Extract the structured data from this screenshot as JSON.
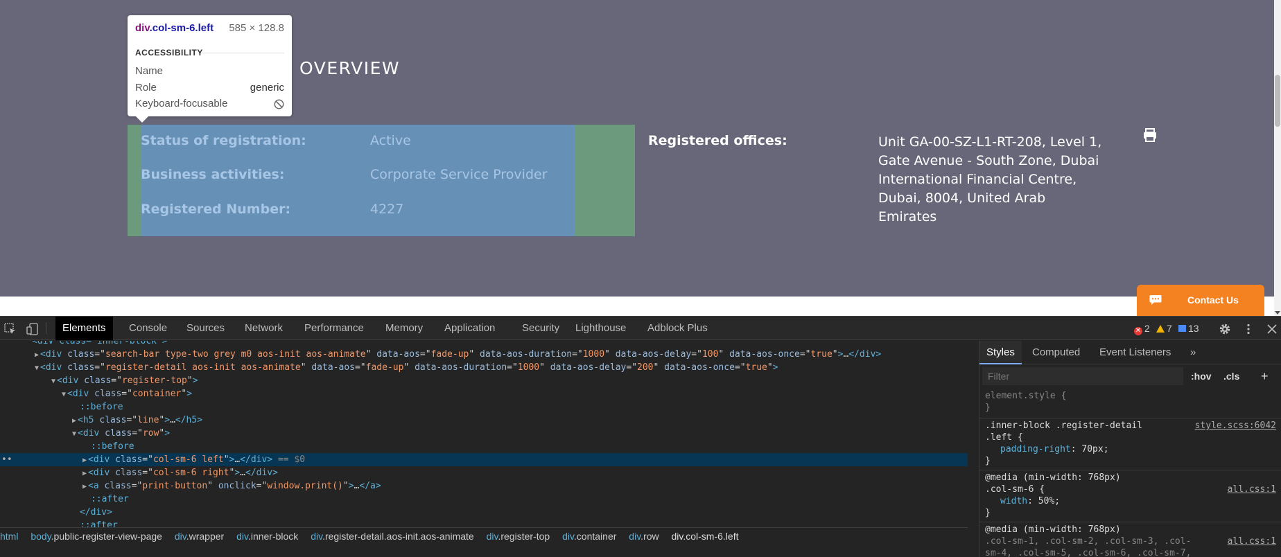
{
  "page": {
    "overview_title": "OVERVIEW",
    "registration": [
      {
        "label": "Status of registration:",
        "value": "Active"
      },
      {
        "label": "Business activities:",
        "value": "Corporate Service Provider"
      },
      {
        "label": "Registered Number:",
        "value": "4227"
      }
    ],
    "offices_label": "Registered offices:",
    "offices_address": "Unit GA-00-SZ-L1-RT-208, Level 1, Gate Avenue - South Zone, Dubai International Financial Centre, Dubai, 8004, United Arab Emirates",
    "print_icon": "printer-icon",
    "contact_label": "Contact Us",
    "contact_icon": "chat-bubble-icon"
  },
  "tooltip": {
    "tag": "div",
    "cls": ".col-sm-6.left",
    "dimensions": "585 × 128.8",
    "section": "ACCESSIBILITY",
    "name_key": "Name",
    "name_val": "",
    "role_key": "Role",
    "role_val": "generic",
    "focus_key": "Keyboard-focusable",
    "focus_icon": "not-allowed-icon"
  },
  "devtools": {
    "tabs": [
      "Elements",
      "Console",
      "Sources",
      "Network",
      "Performance",
      "Memory",
      "Application",
      "Security",
      "Lighthouse",
      "Adblock Plus"
    ],
    "active_tab": "Elements",
    "errors": "2",
    "warnings": "7",
    "messages": "13",
    "code": {
      "l0": "<div class=\"inner-block\">",
      "l1_tag": "div",
      "l1_class": "search-bar type-two grey m0 aos-init aos-animate",
      "l1_aos": "fade-up",
      "l1_dur": "1000",
      "l1_delay": "100",
      "l1_once": "true",
      "l2_class": "register-detail aos-init aos-animate",
      "l2_aos": "fade-up",
      "l2_dur": "1000",
      "l2_delay": "200",
      "l2_once": "true",
      "l3_class": "register-top",
      "l4_class": "container",
      "before": "::before",
      "l6_class": "line",
      "l7_class": "row",
      "l9_class": "col-sm-6 left",
      "selected_marker": "== $0",
      "l10_class": "col-sm-6 right",
      "l11_class": "print-button",
      "l11_onclick": "window.print()",
      "after": "::after"
    },
    "breadcrumbs": [
      {
        "tag": "html",
        "cls": ""
      },
      {
        "tag": "body",
        "cls": ".public-register-view-page"
      },
      {
        "tag": "div",
        "cls": ".wrapper"
      },
      {
        "tag": "div",
        "cls": ".inner-block"
      },
      {
        "tag": "div",
        "cls": ".register-detail.aos-init.aos-animate"
      },
      {
        "tag": "div",
        "cls": ".register-top"
      },
      {
        "tag": "div",
        "cls": ".container"
      },
      {
        "tag": "div",
        "cls": ".row"
      },
      {
        "tag": "div",
        "cls": ".col-sm-6.left"
      }
    ],
    "styles": {
      "tabs": [
        "Styles",
        "Computed",
        "Event Listeners"
      ],
      "more": "»",
      "filter_placeholder": "Filter",
      "hov": ":hov",
      "cls": ".cls",
      "plus": "+",
      "element_style": "element.style {",
      "close": "}",
      "rule1_selector_a": ".inner-block .register-detail",
      "rule1_selector_b": ".left {",
      "rule1_source": "style.scss:6042",
      "rule1_prop": "padding-right",
      "rule1_val": "70px;",
      "media1": "@media (min-width: 768px)",
      "rule2_selector": ".col-sm-6 {",
      "rule2_source": "all.css:1",
      "rule2_prop": "width",
      "rule2_val": "50%;",
      "media2": "@media (min-width: 768px)",
      "rule3_selector": ".col-sm-1, .col-sm-2, .col-sm-3, .col-",
      "rule3_selector_b": "sm-4, .col-sm-5, .col-sm-6, .col-sm-7,",
      "rule3_source": "all.css:1"
    }
  }
}
